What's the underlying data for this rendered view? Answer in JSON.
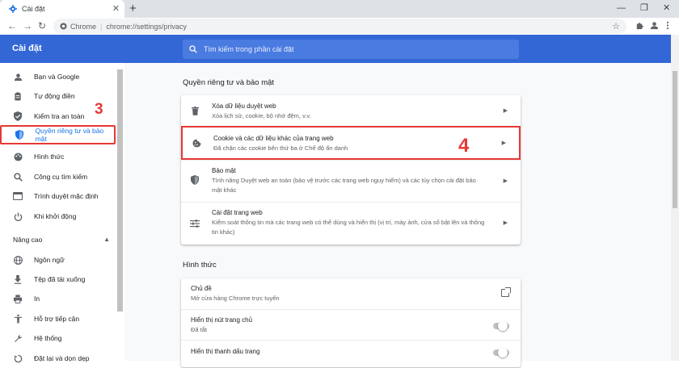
{
  "tab": {
    "title": "Cài đặt",
    "close": "✕"
  },
  "window": {
    "minimize": "—",
    "restore": "❐",
    "close": "✕"
  },
  "toolbar": {
    "back": "←",
    "forward": "→",
    "reload": "↻",
    "site_label": "Chrome",
    "url": "chrome://settings/privacy",
    "star": "☆"
  },
  "header": {
    "title": "Cài đặt",
    "search_placeholder": "Tìm kiếm trong phần cài đặt"
  },
  "sidebar": {
    "items": [
      {
        "label": "Bạn và Google",
        "icon": "person-icon"
      },
      {
        "label": "Tự động điền",
        "icon": "clipboard-icon"
      },
      {
        "label": "Kiểm tra an toàn",
        "icon": "shield-check-icon"
      },
      {
        "label": "Quyền riêng tư và bảo mật",
        "icon": "shield-icon"
      },
      {
        "label": "Hình thức",
        "icon": "palette-icon"
      },
      {
        "label": "Công cụ tìm kiếm",
        "icon": "search-icon"
      },
      {
        "label": "Trình duyệt mặc định",
        "icon": "browser-icon"
      },
      {
        "label": "Khi khởi động",
        "icon": "power-icon"
      }
    ],
    "advanced_label": "Nâng cao",
    "advanced_items": [
      {
        "label": "Ngôn ngữ",
        "icon": "globe-icon"
      },
      {
        "label": "Tệp đã tải xuống",
        "icon": "download-icon"
      },
      {
        "label": "In",
        "icon": "printer-icon"
      },
      {
        "label": "Hỗ trợ tiếp cận",
        "icon": "accessibility-icon"
      },
      {
        "label": "Hệ thống",
        "icon": "wrench-icon"
      },
      {
        "label": "Đặt lại và dọn dẹp",
        "icon": "reset-icon"
      }
    ]
  },
  "annotations": {
    "step3": "3",
    "step4": "4"
  },
  "privacy": {
    "title": "Quyền riêng tư và bảo mật",
    "rows": [
      {
        "title": "Xóa dữ liệu duyệt web",
        "desc": "Xóa lịch sử, cookie, bộ nhớ đệm, v.v."
      },
      {
        "title": "Cookie và các dữ liệu khác của trang web",
        "desc": "Đã chặn các cookie bên thứ ba ở Chế độ ẩn danh"
      },
      {
        "title": "Bảo mật",
        "desc": "Tính năng Duyệt web an toàn (bảo vệ trước các trang web nguy hiểm) và các tùy chọn cài đặt bảo mật khác"
      },
      {
        "title": "Cài đặt trang web",
        "desc": "Kiểm soát thông tin mà các trang web có thể dùng và hiển thị (vị trí, máy ảnh, cửa sổ bật lên và thông tin khác)"
      }
    ]
  },
  "appearance": {
    "title": "Hình thức",
    "rows": [
      {
        "title": "Chủ đề",
        "desc": "Mở cửa hàng Chrome trực tuyến"
      },
      {
        "title": "Hiển thị nút trang chủ",
        "desc": "Đã tắt"
      },
      {
        "title": "Hiển thị thanh dấu trang",
        "desc": ""
      }
    ]
  },
  "colors": {
    "accent": "#3367d6",
    "highlight": "#e53935",
    "active_text": "#1a73e8"
  }
}
